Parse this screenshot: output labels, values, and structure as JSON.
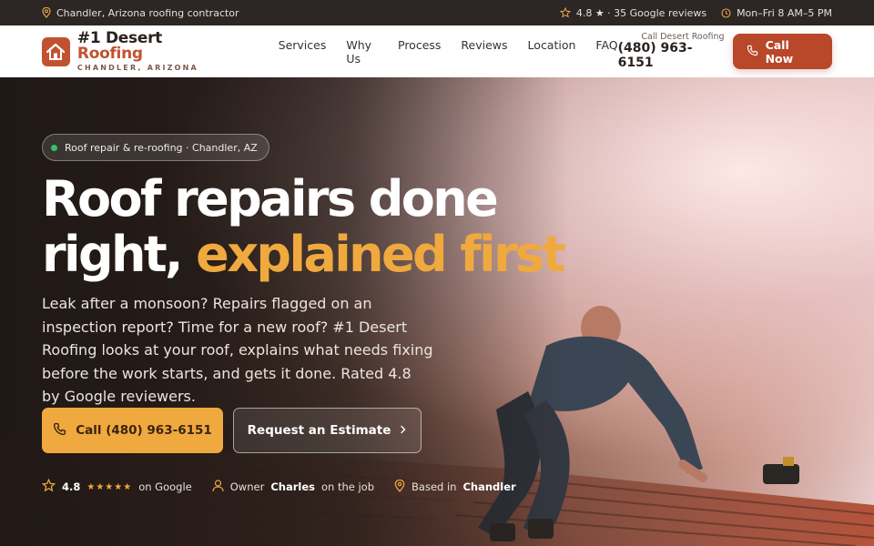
{
  "topbar": {
    "location": "Chandler, Arizona roofing contractor",
    "rating": "4.8 ★ · 35 Google reviews",
    "hours": "Mon–Fri 8 AM–5 PM"
  },
  "header": {
    "brand_primary": "#1 Desert",
    "brand_accent": "Roofing",
    "brand_sub": "CHANDLER, ARIZONA",
    "nav": [
      "Services",
      "Why Us",
      "Process",
      "Reviews",
      "Location",
      "FAQ"
    ],
    "call_label": "Call Desert Roofing",
    "call_phone": "(480) 963-6151",
    "call_button": "Call Now"
  },
  "hero": {
    "badge": "Roof repair & re-roofing · Chandler, AZ",
    "headline_line1": "Roof repairs done",
    "headline_line2_plain": "right, ",
    "headline_line2_accent": "explained first",
    "lede": "Leak after a monsoon? Repairs flagged on an inspection report? Time for a new roof? #1 Desert Roofing looks at your roof, explains what needs fixing before the work starts, and gets it done. Rated 4.8 by Google reviewers.",
    "cta_primary": "Call (480) 963-6151",
    "cta_secondary": "Request an Estimate"
  },
  "trust": {
    "rating_value": "4.8",
    "rating_stars": "★★★★★",
    "rating_suffix": "on Google",
    "owner_prefix": "Owner",
    "owner_name": "Charles",
    "owner_suffix": "on the job",
    "base_prefix": "Based in",
    "base_city": "Chandler"
  },
  "colors": {
    "brand": "#c2522f",
    "accent": "#f0a93e",
    "topbar_bg": "#2c2624",
    "status_dot": "#35c06a"
  },
  "icons": {
    "topbar_location": "map-pin-icon",
    "topbar_rating": "star-icon",
    "topbar_hours": "clock-icon",
    "logo": "house-icon",
    "call": "phone-icon",
    "secondary_arrow": "chevron-right-icon",
    "trust_rating": "star-icon",
    "trust_owner": "user-icon",
    "trust_base": "map-pin-icon"
  }
}
